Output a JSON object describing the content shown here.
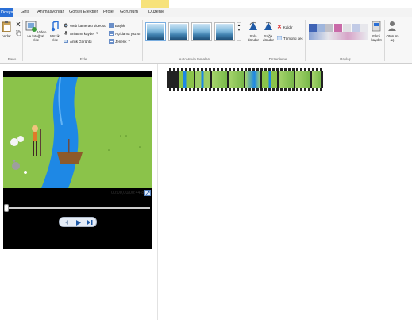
{
  "tabs": {
    "file": "Dosya",
    "items": [
      "Giriş",
      "Animasyonlar",
      "Görsel Efektler",
      "Proje",
      "Görünüm",
      "Düzenle"
    ]
  },
  "ribbon": {
    "groups": {
      "clipboard": "Pano",
      "add": "Ekle",
      "themes": "AutoMovie temaları",
      "editing": "Düzenleme",
      "share": "Paylaş"
    },
    "paste_label": "ondar",
    "add_video_label": "Video ve fotoğraf ekle",
    "add_music_label": "Müzik ekle",
    "webcam_label": "Web kamerası videosu",
    "narration_label": "Anlatımı kaydet",
    "snapshot_label": "Anlık Görüntü",
    "title_label": "Başlık",
    "caption_label": "Açıklama yazısı",
    "credits_label": "Jenerik",
    "rotate_left_label": "Sola döndür",
    "rotate_right_label": "Sağa döndür",
    "remove_label": "Kaldır",
    "select_all_label": "Tümünü seç",
    "save_movie_label": "Filmi kaydet",
    "sign_in_label": "Oturum aç"
  },
  "player": {
    "timecode": "00:00,00/00:44,88"
  },
  "colors": {
    "file_tab": "#2a6fd6",
    "contextual_tab": "#f7e27a",
    "accent": "#2a6fd6"
  }
}
